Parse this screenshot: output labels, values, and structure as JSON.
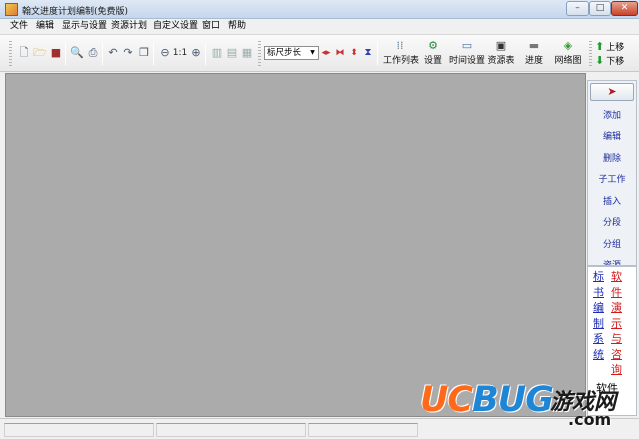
{
  "window": {
    "title": "翰文进度计划编制(免费版)",
    "min_glyph": "–",
    "max_glyph": "□",
    "close_glyph": "✕"
  },
  "menu": [
    {
      "label": "文件"
    },
    {
      "label": "编辑"
    },
    {
      "label": "显示与设置"
    },
    {
      "label": "资源计划"
    },
    {
      "label": "自定义设置"
    },
    {
      "label": "窗口"
    },
    {
      "label": "帮助"
    }
  ],
  "toolbar": {
    "ruler_select_value": "标尺步长",
    "zoom_reset_label": "1:1",
    "big_buttons": [
      {
        "label": "工作列表",
        "icon": "task-list-icon"
      },
      {
        "label": "设置",
        "icon": "settings-icon"
      },
      {
        "label": "时间设置",
        "icon": "time-settings-icon"
      },
      {
        "label": "资源表",
        "icon": "resource-table-icon"
      },
      {
        "label": "进度",
        "icon": "progress-icon"
      },
      {
        "label": "网络图",
        "icon": "network-diagram-icon"
      }
    ],
    "move_up_label": "上移",
    "move_down_label": "下移"
  },
  "right_panel": {
    "pointer_icon": "pointer-icon",
    "items": [
      {
        "label": "添加"
      },
      {
        "label": "编辑"
      },
      {
        "label": "删除"
      },
      {
        "label": "子工作"
      },
      {
        "label": "插入"
      },
      {
        "label": "分段"
      },
      {
        "label": "分组"
      },
      {
        "label": "资源"
      }
    ]
  },
  "side_links": {
    "link1": "标书编制系统",
    "link2": "软件演示与咨询",
    "bottom_text": "软件"
  },
  "watermark": {
    "brand_part1": "UC",
    "brand_part2": "BUG",
    "cn_text": "游戏网",
    "domain_text": ".com"
  },
  "colors": {
    "workarea": "#ababab",
    "link_blue": "#1d2fb5",
    "link_red": "#d11b1b",
    "accent_orange": "#ff6a1a",
    "accent_blue": "#1f86d6"
  }
}
